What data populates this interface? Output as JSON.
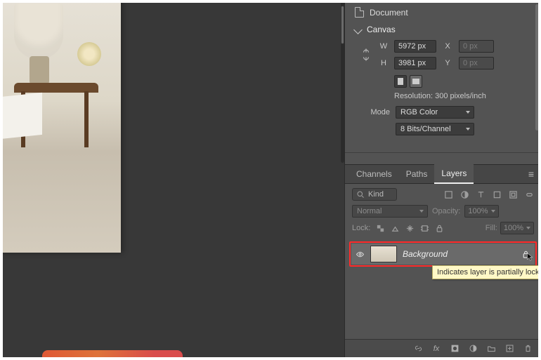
{
  "properties": {
    "document_label": "Document",
    "canvas_label": "Canvas",
    "w_label": "W",
    "h_label": "H",
    "x_label": "X",
    "y_label": "Y",
    "width_value": "5972 px",
    "height_value": "3981 px",
    "x_value": "0 px",
    "y_value": "0 px",
    "resolution_text": "Resolution: 300 pixels/inch",
    "mode_label": "Mode",
    "mode_value": "RGB Color",
    "depth_value": "8 Bits/Channel"
  },
  "panel_tabs": {
    "channels": "Channels",
    "paths": "Paths",
    "layers": "Layers"
  },
  "layers_panel": {
    "filter_kind_label": "Kind",
    "blend_mode": "Normal",
    "opacity_label": "Opacity:",
    "opacity_value": "100%",
    "lock_label": "Lock:",
    "fill_label": "Fill:",
    "fill_value": "100%",
    "layer0_name": "Background",
    "tooltip_text": "Indicates layer is partially locked"
  }
}
